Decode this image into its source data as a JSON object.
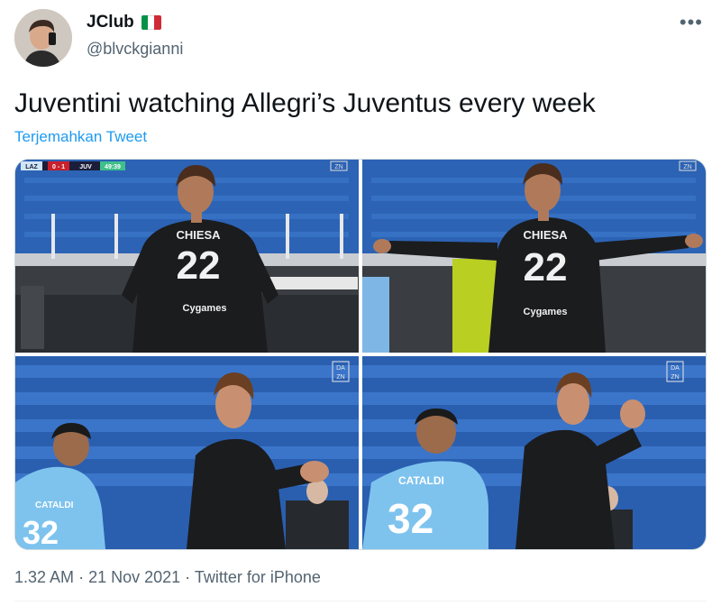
{
  "user": {
    "display_name": "JClub",
    "handle": "@blvckgianni",
    "flag_colors": [
      "#009246",
      "#ffffff",
      "#ce2b37"
    ]
  },
  "tweet": {
    "text": "Juventini watching Allegri’s Juventus every week",
    "translate_label": "Terjemahkan Tweet"
  },
  "media": {
    "panels": [
      {
        "scoreboard": {
          "home": "LAZ",
          "score": "0 - 1",
          "away": "JUV",
          "clock": "49:39"
        },
        "watermark": "ZN",
        "jersey_name": "CHIESA",
        "jersey_number": "22",
        "sponsor": "Cygames"
      },
      {
        "watermark": "ZN",
        "jersey_name": "CHIESA",
        "jersey_number": "22",
        "sponsor": "Cygames"
      },
      {
        "watermark_top": "DA",
        "watermark_bottom": "ZN",
        "jersey_name": "CATALDI",
        "jersey_number": "32"
      },
      {
        "watermark_top": "DA",
        "watermark_bottom": "ZN",
        "jersey_name": "CATALDI",
        "jersey_number": "32"
      }
    ]
  },
  "meta": {
    "time": "1.32 AM",
    "separator": "·",
    "date": "21 Nov 2021",
    "source": "Twitter for iPhone"
  },
  "colors": {
    "link": "#1d9bf0",
    "muted": "#536471",
    "stadium_blue": "#2a5fb0",
    "lazio_blue": "#7ec3ee"
  }
}
